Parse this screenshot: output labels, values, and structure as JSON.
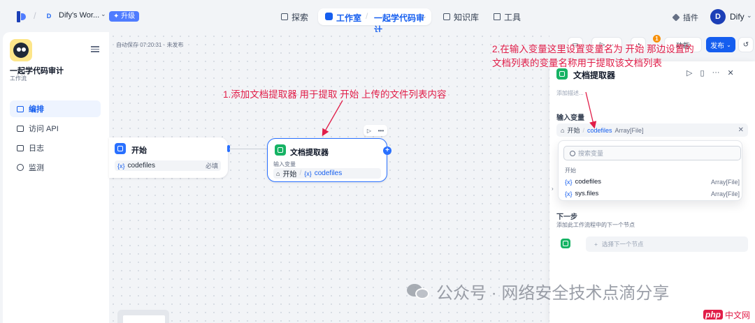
{
  "header": {
    "workspace_initial": "D",
    "workspace_name": "Dify's Wor...",
    "upgrade_label": "升级",
    "nav": {
      "explore": "探索",
      "studio": "工作室",
      "app": "一起学代码审计",
      "knowledge": "知识库",
      "tools": "工具"
    },
    "plugins_label": "插件",
    "user_initial": "D",
    "user_name": "Dify"
  },
  "sidebar": {
    "app_name": "一起学代码审计",
    "app_type": "工作流",
    "items": [
      {
        "label": "编排",
        "icon": "layout-icon",
        "active": true
      },
      {
        "label": "访问 API",
        "icon": "terminal-icon"
      },
      {
        "label": "日志",
        "icon": "log-icon"
      },
      {
        "label": "监测",
        "icon": "monitor-icon"
      }
    ]
  },
  "canvas": {
    "autosave": "自动保存 07:20:31 · 未发布",
    "annotation": "1.添加文档提取器 用于提取 开始 上传的文件列表内容",
    "start_node": {
      "title": "开始",
      "var": "codefiles",
      "required": "必填"
    },
    "doc_node": {
      "title": "文档提取器",
      "label": "输入变量",
      "source": "开始",
      "var": "codefiles"
    },
    "toolbar": {
      "feature_label": "功能",
      "publish_label": "发布",
      "badge": "1"
    }
  },
  "panel": {
    "annotation": "2.在输入变量这里设置变量名为 开始 那边设置的文档列表的变量名称用于提取该文档列表",
    "title": "文档提取器",
    "desc_placeholder": "添加描述...",
    "input_title": "输入变量",
    "selected": {
      "source": "开始",
      "var": "codefiles",
      "type": "Array[File]"
    },
    "search_placeholder": "搜索变量",
    "group": "开始",
    "options": [
      {
        "name": "codefiles",
        "type": "Array[File]"
      },
      {
        "name": "sys.files",
        "type": "Array[File]"
      }
    ],
    "next_title": "下一步",
    "next_desc": "添加此工作流程中的下一个节点",
    "next_select": "选择下一个节点"
  },
  "watermark": "公众号 · 网络安全技术点滴分享",
  "site_badge": {
    "brand": "php",
    "text": "中文网"
  },
  "colors": {
    "primary": "#155eef",
    "annotation": "#e11d48",
    "success": "#16b364"
  }
}
